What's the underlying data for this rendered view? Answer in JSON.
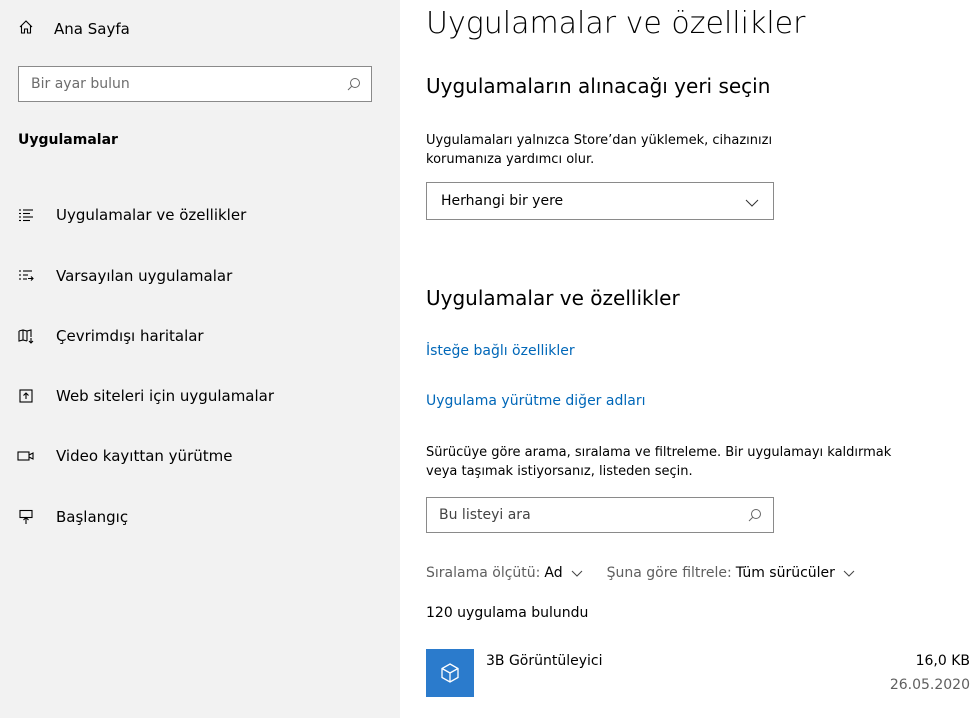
{
  "sidebar": {
    "home_label": "Ana Sayfa",
    "search_placeholder": "Bir ayar bulun",
    "section_title": "Uygulamalar",
    "items": [
      {
        "label": "Uygulamalar ve özellikler",
        "icon": "apps-features-icon"
      },
      {
        "label": "Varsayılan uygulamalar",
        "icon": "default-apps-icon"
      },
      {
        "label": "Çevrimdışı haritalar",
        "icon": "offline-maps-icon"
      },
      {
        "label": "Web siteleri için uygulamalar",
        "icon": "apps-for-websites-icon"
      },
      {
        "label": "Video kayıttan yürütme",
        "icon": "video-playback-icon"
      },
      {
        "label": "Başlangıç",
        "icon": "startup-icon"
      }
    ]
  },
  "main": {
    "title": "Uygulamalar ve özellikler",
    "install_section": {
      "heading": "Uygulamaların alınacağı yeri seçin",
      "description_line1": "Uygulamaları yalnızca Store’dan yüklemek, cihazınızı",
      "description_line2": "korumanıza yardımcı olur.",
      "dropdown_value": "Herhangi bir yere"
    },
    "apps_section": {
      "heading": "Uygulamalar ve özellikler",
      "link_optional": "İsteğe bağlı özellikler",
      "link_aliases": "Uygulama yürütme diğer adları",
      "description_line1": "Sürücüye göre arama, sıralama ve filtreleme. Bir uygulamayı kaldırmak",
      "description_line2": "veya taşımak istiyorsanız, listeden seçin.",
      "search_placeholder": "Bu listeyi ara",
      "sort_label": "Sıralama ölçütü:",
      "sort_value": "Ad",
      "filter_label": "Şuna göre filtrele:",
      "filter_value": "Tüm sürücüler",
      "count_text": "120 uygulama bulundu",
      "apps": [
        {
          "name": "3B Görüntüleyici",
          "size": "16,0 KB",
          "date": "26.05.2020",
          "icon": "3d-viewer-icon"
        }
      ]
    }
  },
  "colors": {
    "sidebar_bg": "#f2f2f2",
    "link": "#0067b8",
    "app_tile": "#2b7bcc"
  }
}
